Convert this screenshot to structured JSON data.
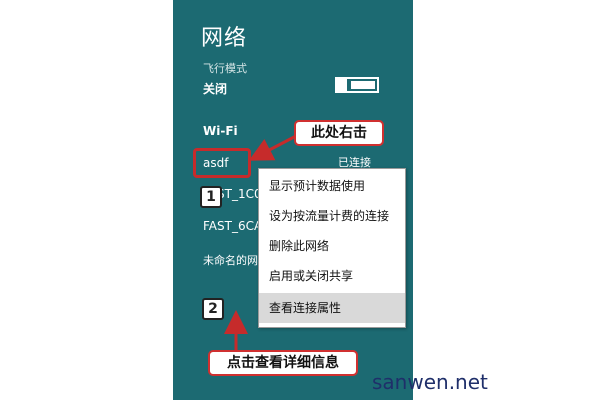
{
  "panel": {
    "title": "网络",
    "airplane_mode_label": "飞行模式",
    "airplane_mode_state": "关闭",
    "wifi_header": "Wi-Fi"
  },
  "networks": [
    {
      "name": "asdf",
      "status": "已连接"
    },
    {
      "name": "FAST_1C0"
    },
    {
      "name": "FAST_6CA"
    },
    {
      "name": "未命名的网络"
    }
  ],
  "context_menu": {
    "items": [
      "显示预计数据使用",
      "设为按流量计费的连接",
      "删除此网络",
      "启用或关闭共享",
      "查看连接属性"
    ]
  },
  "annotations": {
    "right_click_callout": "此处右击",
    "details_callout": "点击查看详细信息",
    "step_1": "1",
    "step_2": "2"
  },
  "watermark": "sanwen.net",
  "colors": {
    "panel_bg": "#1c6a72",
    "highlight_red": "#c62b2b",
    "menu_hover": "#d9d9d9"
  }
}
